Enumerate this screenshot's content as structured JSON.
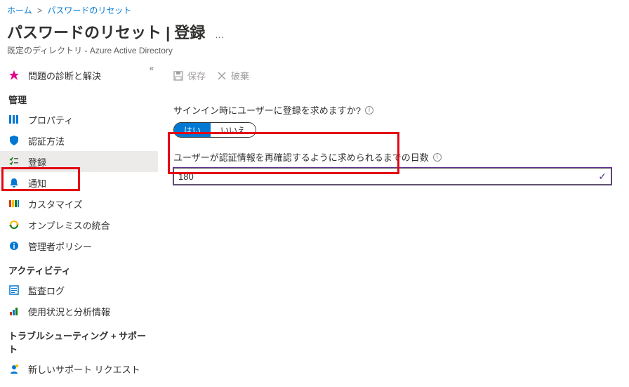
{
  "breadcrumb": {
    "home": "ホーム",
    "current": "パスワードのリセット"
  },
  "header": {
    "title": "パスワードのリセット | 登録",
    "subtitle": "既定のディレクトリ - Azure Active Directory"
  },
  "sidebar": {
    "diagnose": "問題の診断と解決",
    "groups": {
      "manage": "管理",
      "activity": "アクティビティ",
      "troubleshoot": "トラブルシューティング + サポート"
    },
    "items": {
      "properties": "プロパティ",
      "authMethods": "認証方法",
      "registration": "登録",
      "notifications": "通知",
      "customize": "カスタマイズ",
      "onprem": "オンプレミスの統合",
      "adminPolicy": "管理者ポリシー",
      "auditLogs": "監査ログ",
      "usageInsights": "使用状況と分析情報",
      "newSupport": "新しいサポート リクエスト"
    }
  },
  "toolbar": {
    "save": "保存",
    "discard": "破棄"
  },
  "form": {
    "requireRegisterLabel": "サインイン時にユーザーに登録を求めますか?",
    "yes": "はい",
    "no": "いいえ",
    "daysLabel": "ユーザーが認証情報を再確認するように求められるまでの日数",
    "daysValue": "180"
  },
  "colors": {
    "accent": "#0078d4",
    "highlight": "#e30613",
    "inputFocus": "#5c2d91"
  }
}
